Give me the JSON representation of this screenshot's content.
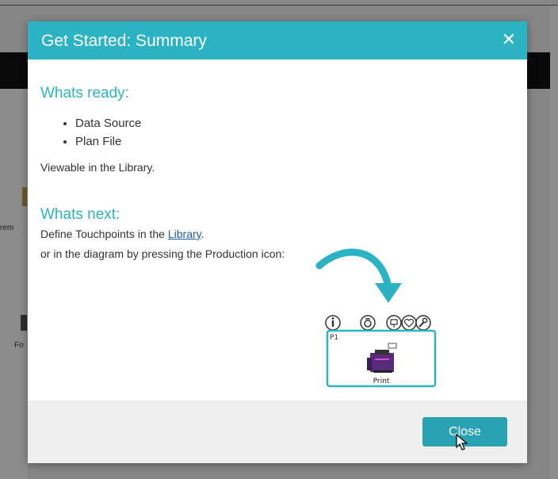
{
  "background_app": {
    "sidebar_labels": [
      "rem",
      "Fo"
    ]
  },
  "dialog": {
    "title": "Get Started: Summary",
    "close_icon": "close-icon",
    "whats_ready": {
      "heading": "Whats ready:",
      "items": [
        "Data Source",
        "Plan File"
      ],
      "note": "Viewable in the Library."
    },
    "whats_next": {
      "heading": "Whats next:",
      "line1_prefix": "Define Touchpoints in the ",
      "line1_link": "Library",
      "line1_suffix": ".",
      "line2": "or in the diagram by pressing the Production icon:"
    },
    "illustration": {
      "node_id": "P1",
      "node_label": "Print",
      "toolbar_icons": [
        "info-icon",
        "production-icon",
        "touchpoint-icon",
        "heart-icon",
        "wrench-icon"
      ],
      "accent_color": "#2bb3c4"
    },
    "footer": {
      "close_label": "Close"
    }
  }
}
